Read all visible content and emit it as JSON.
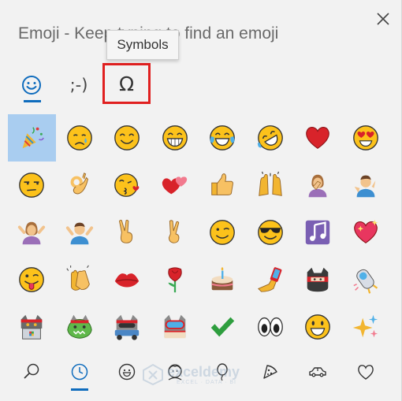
{
  "header": {
    "title": "Emoji - Keep typing to find an emoji",
    "close_icon": "close-icon"
  },
  "tooltip": {
    "text": "Symbols"
  },
  "tabs": [
    {
      "name": "emoji",
      "icon": "smiley-icon",
      "selected": true
    },
    {
      "name": "kaomoji",
      "label": ";-)",
      "selected": false
    },
    {
      "name": "symbols",
      "label": "Ω",
      "selected": false,
      "highlighted": true,
      "highlight_color": "#e02020"
    }
  ],
  "emoji_grid": {
    "selected_index": 0,
    "selection_color": "#a9cdf0",
    "rows": [
      [
        "party-popper",
        "disappointed-relieved",
        "smiling-face",
        "grinning-face",
        "face-with-tears-of-joy",
        "rolling-on-floor-laughing",
        "red-heart",
        "heart-eyes"
      ],
      [
        "unamused-face",
        "ok-hand",
        "face-blowing-kiss",
        "two-hearts",
        "thumbs-up",
        "raising-hands",
        "person-facepalming",
        "person-shrugging"
      ],
      [
        "person-gesturing-no",
        "person-shrugging-blue",
        "victory-hand",
        "crossed-fingers",
        "winking-face",
        "smiling-face-with-sunglasses",
        "musical-notes",
        "sparkling-heart"
      ],
      [
        "winking-face-with-tongue",
        "clapping-hands",
        "kiss-mark",
        "rose",
        "birthday-cake",
        "selfie",
        "ninja-cat",
        "astro-cat"
      ],
      [
        "hacker-cat",
        "dino-cat",
        "stunt-cat",
        "diver-cat",
        "check-mark",
        "eyes",
        "grinning-face-big",
        "sparkles"
      ]
    ]
  },
  "categories": [
    {
      "name": "search",
      "icon": "search-icon",
      "selected": false
    },
    {
      "name": "recently-used",
      "icon": "clock-icon",
      "selected": true
    },
    {
      "name": "smileys",
      "icon": "smiley-icon",
      "selected": false
    },
    {
      "name": "people",
      "icon": "person-icon",
      "selected": false
    },
    {
      "name": "celebrations",
      "icon": "balloon-icon",
      "selected": false
    },
    {
      "name": "food",
      "icon": "pizza-icon",
      "selected": false
    },
    {
      "name": "travel",
      "icon": "car-icon",
      "selected": false
    },
    {
      "name": "symbols",
      "icon": "heart-icon",
      "selected": false
    }
  ],
  "watermark": {
    "brand": "exceldemy",
    "tagline": "EXCEL · DATA · BI"
  },
  "colors": {
    "accent": "#0f6cbd",
    "panel_bg": "#f2f2f2",
    "highlight_box": "#e02020"
  }
}
